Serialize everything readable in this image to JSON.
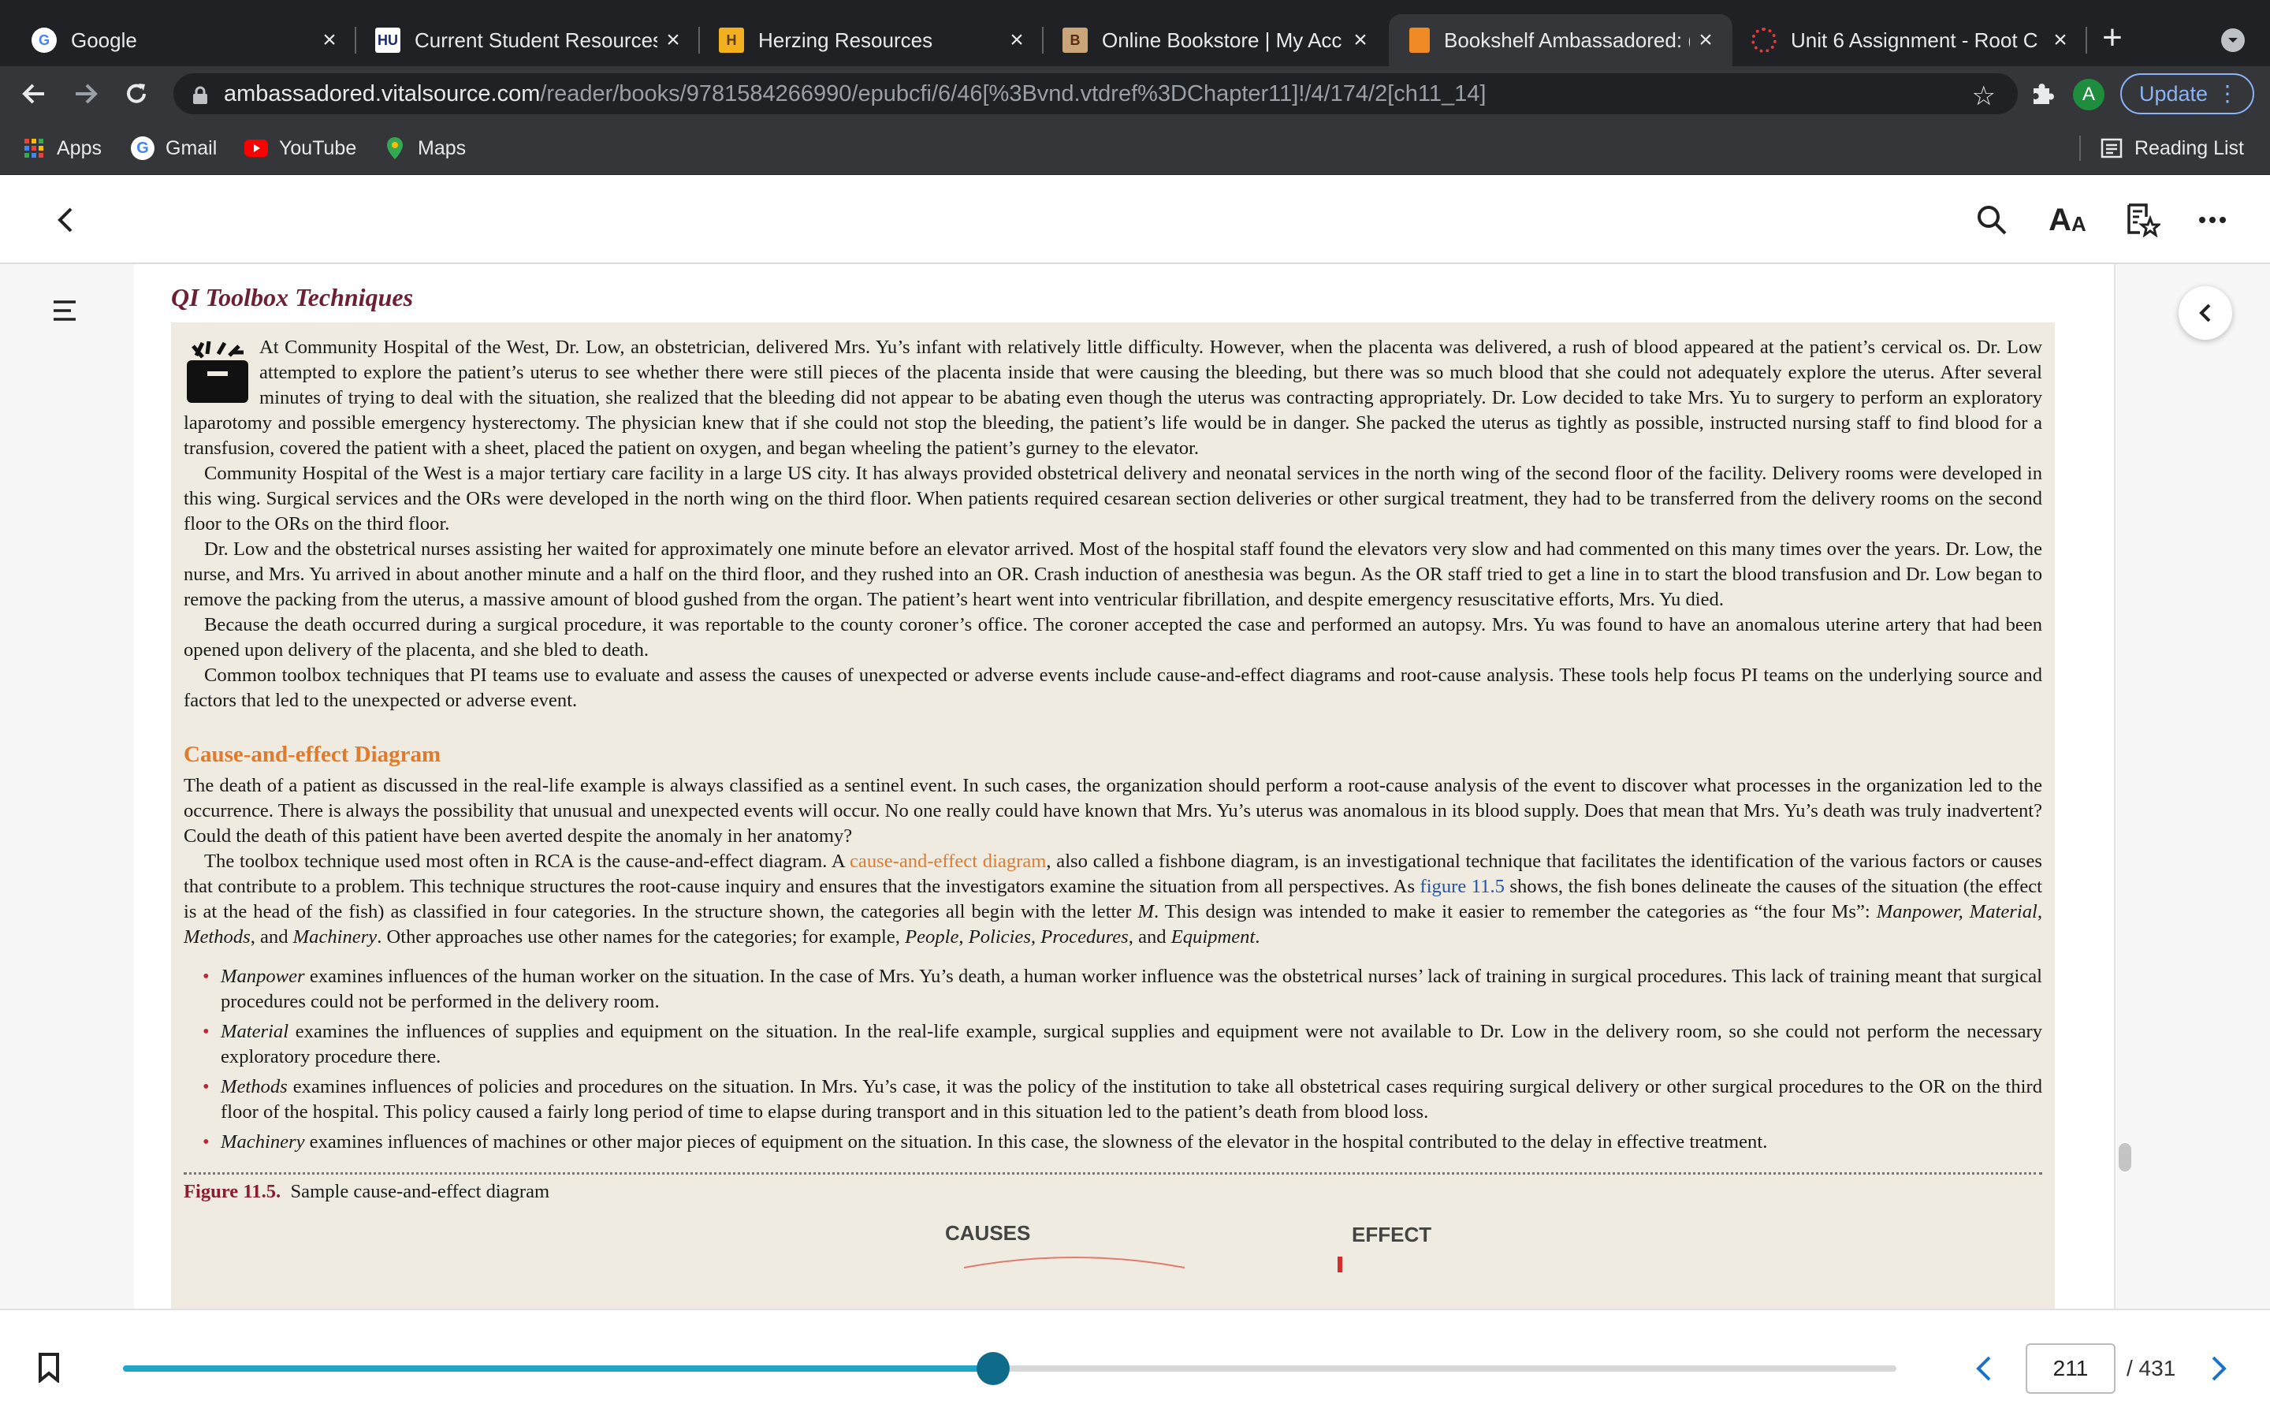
{
  "browser": {
    "tabs": [
      {
        "title": "Google",
        "icon": "google-icon",
        "active": false
      },
      {
        "title": "Current Student Resources",
        "icon": "hu-icon",
        "active": false
      },
      {
        "title": "Herzing Resources",
        "icon": "herzing-icon",
        "active": false
      },
      {
        "title": "Online Bookstore | My Acc",
        "icon": "bookstore-icon",
        "active": false
      },
      {
        "title": "Bookshelf Ambassadored: (",
        "icon": "bookshelf-icon",
        "active": true
      },
      {
        "title": "Unit 6 Assignment - Root C",
        "icon": "unit-icon",
        "active": false
      }
    ],
    "url_host": "ambassadored.vitalsource.com",
    "url_path": "/reader/books/9781584266990/epubcfi/6/46[%3Bvnd.vtdref%3DChapter11]!/4/174/2[ch11_14]",
    "profile_initial": "A",
    "update_label": "Update",
    "bookmarks": [
      {
        "label": "Apps",
        "icon": "apps-icon"
      },
      {
        "label": "Gmail",
        "icon": "google-icon"
      },
      {
        "label": "YouTube",
        "icon": "youtube-icon"
      },
      {
        "label": "Maps",
        "icon": "maps-icon"
      }
    ],
    "reading_list_label": "Reading List",
    "colors": {
      "tabbar": "#202124",
      "toolbar": "#35363a",
      "active_tab": "#35363a",
      "update_border": "#8ab4f8"
    }
  },
  "reader": {
    "chapter_title": "QI Toolbox Techniques",
    "paragraphs": [
      "At Community Hospital of the West, Dr. Low, an obstetrician, delivered Mrs. Yu’s infant with relatively little difficulty. However, when the placenta was delivered, a rush of blood appeared at the patient’s cervical os. Dr. Low attempted to explore the patient’s uterus to see whether there were still pieces of the placenta inside that were causing the bleeding, but there was so much blood that she could not adequately explore the uterus. After several minutes of trying to deal with the situation, she realized that the bleeding did not appear to be abating even though the uterus was contracting appropriately. Dr. Low decided to take Mrs. Yu to surgery to perform an exploratory laparotomy and possible emergency hysterectomy. The physician knew that if she could not stop the bleeding, the patient’s life would be in danger. She packed the uterus as tightly as possible, instructed nursing staff to find blood for a transfusion, covered the patient with a sheet, placed the patient on oxygen, and began wheeling the patient’s gurney to the elevator.",
      "Community Hospital of the West is a major tertiary care facility in a large US city. It has always provided obstetrical delivery and neonatal services in the north wing of the second floor of the facility. Delivery rooms were developed in this wing. Surgical services and the ORs were developed in the north wing on the third floor. When patients required cesarean section deliveries or other surgical treatment, they had to be transferred from the delivery rooms on the second floor to the ORs on the third floor.",
      "Dr. Low and the obstetrical nurses assisting her waited for approximately one minute before an elevator arrived. Most of the hospital staff found the elevators very slow and had commented on this many times over the years. Dr. Low, the nurse, and Mrs. Yu arrived in about another minute and a half on the third floor, and they rushed into an OR. Crash induction of anesthesia was begun. As the OR staff tried to get a line in to start the blood transfusion and Dr. Low began to remove the packing from the uterus, a massive amount of blood gushed from the organ. The patient’s heart went into ventricular fibrillation, and despite emergency resuscitative efforts, Mrs. Yu died.",
      "Because the death occurred during a surgical procedure, it was reportable to the county coroner’s office. The coroner accepted the case and performed an autopsy. Mrs. Yu was found to have an anomalous uterine artery that had been opened upon delivery of the placenta, and she bled to death.",
      "Common toolbox techniques that PI teams use to evaluate and assess the causes of unexpected or adverse events include cause-and-effect diagrams and root-cause analysis. These tools help focus PI teams on the underlying source and factors that led to the unexpected or adverse event."
    ],
    "section_heading": "Cause-and-effect Diagram",
    "section_p1": "The death of a patient as discussed in the real-life example is always classified as a sentinel event. In such cases, the organization should perform a root-cause analysis of the event to discover what processes in the organization led to the occurrence. There is always the possibility that unusual and unexpected events will occur. No one really could have known that Mrs. Yu’s uterus was anomalous in its blood supply. Does that mean that Mrs. Yu’s death was truly inadvertent? Could the death of this patient have been averted despite the anomaly in her anatomy?",
    "section_p2": {
      "a": "The toolbox technique used most often in RCA is the cause-and-effect diagram. A ",
      "term": "cause-and-effect diagram",
      "b": ", also called a fishbone diagram, is an investigational technique that facilitates the identification of the various factors or causes that contribute to a problem. This technique structures the root-cause inquiry and ensures that the investigators examine the situation from all perspectives. As ",
      "link": "figure 11.5",
      "c": " shows, the fish bones delineate the causes of the situation (the effect is at the head of the fish) as classified in four categories. In the structure shown, the categories all begin with the letter ",
      "m": "M",
      "d": ". This design was intended to make it easier to remember the categories as “the four Ms”: ",
      "four_ms": "Manpower, Material, Methods",
      "e": ", and ",
      "machinery": "Machinery",
      "f": ". Other approaches use other names for the categories; for example, ",
      "alt": "People, Policies, Procedures",
      "g": ", and ",
      "equipment": "Equipment",
      "h": "."
    },
    "bullets": [
      {
        "term": "Manpower",
        "text": " examines influences of the human worker on the situation. In the case of Mrs. Yu’s death, a human worker influence was the obstetrical nurses’ lack of training in surgical procedures. This lack of training meant that surgical procedures could not be performed in the delivery room."
      },
      {
        "term": "Material",
        "text": " examines the influences of supplies and equipment on the situation. In the real-life example, surgical supplies and equipment were not available to Dr. Low in the delivery room, so she could not perform the necessary exploratory procedure there."
      },
      {
        "term": "Methods",
        "text": " examines influences of policies and procedures on the situation. In Mrs. Yu’s case, it was the policy of the institution to take all obstetrical cases requiring surgical delivery or other surgical procedures to the OR on the third floor of the hospital. This policy caused a fairly long period of time to elapse during transport and in this situation led to the patient’s death from blood loss."
      },
      {
        "term": "Machinery",
        "text": " examines influences of machines or other major pieces of equipment on the situation. In this case, the slowness of the elevator in the hospital contributed to the delay in effective treatment."
      }
    ],
    "figure_label": "Figure 11.5.",
    "figure_caption": "Sample cause-and-effect diagram",
    "figure_causes": "CAUSES",
    "figure_effect": "EFFECT",
    "current_page": "211",
    "total_pages": "/ 431",
    "progress_fraction": 0.4907,
    "colors": {
      "heading": "#6d1f34",
      "accent": "#e07b2e",
      "box": "#efebe0",
      "slider": "#1fa6c9",
      "thumb": "#0f6b8a",
      "chevron": "#1a73c8"
    }
  }
}
